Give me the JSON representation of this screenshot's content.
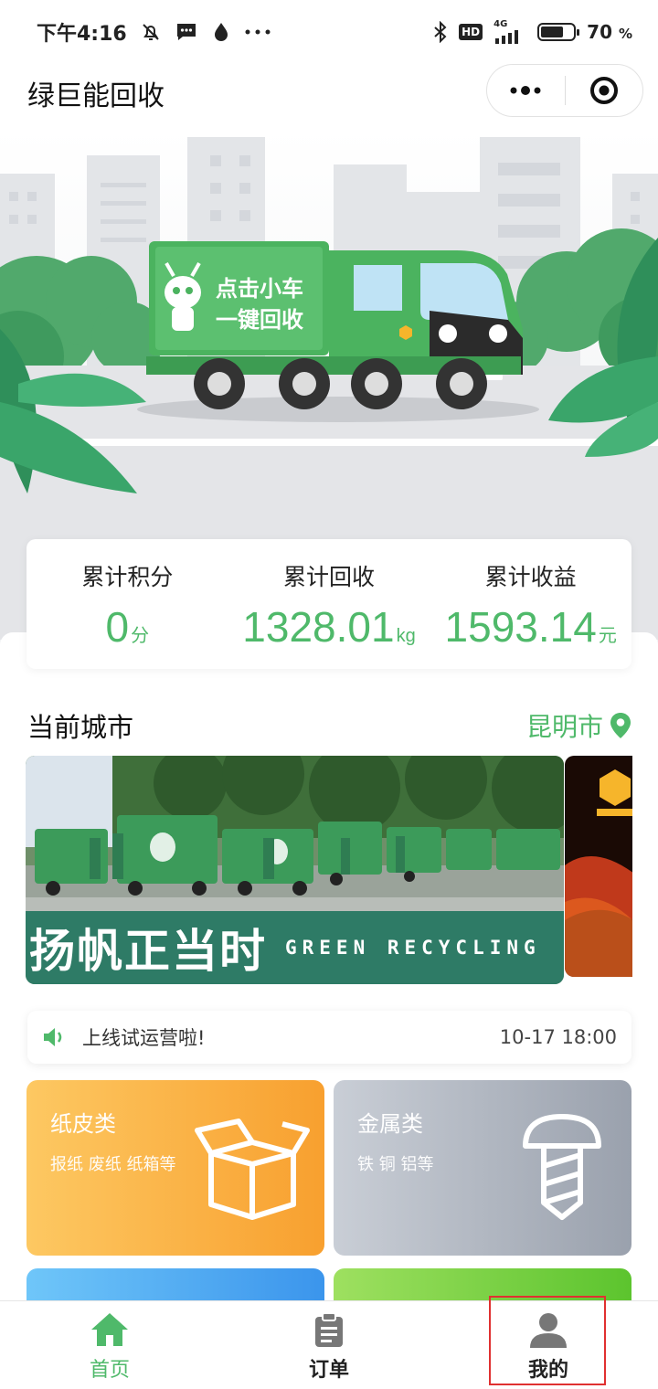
{
  "status_bar": {
    "time": "下午4:16",
    "network": "4G",
    "battery": "70",
    "battery_unit": "%",
    "battery_level": 0.7
  },
  "app": {
    "title": "绿巨能回收"
  },
  "banner": {
    "truck_text_line1": "点击小车",
    "truck_text_line2": "一键回收"
  },
  "stats": [
    {
      "label": "累计积分",
      "value": "0",
      "unit": "分"
    },
    {
      "label": "累计回收",
      "value": "1328.01",
      "unit": "kg"
    },
    {
      "label": "累计收益",
      "value": "1593.14",
      "unit": "元"
    }
  ],
  "city": {
    "title": "当前城市",
    "value": "昆明市"
  },
  "carousel": {
    "caption_cn": "扬帆正当时",
    "caption_en": "GREEN RECYCLING"
  },
  "notice": {
    "text": "上线试运营啦!",
    "time": "10-17 18:00"
  },
  "categories": [
    {
      "title": "纸皮类",
      "subtitle": "报纸 废纸 纸箱等",
      "icon": "box-icon"
    },
    {
      "title": "金属类",
      "subtitle": "铁 铜 铝等",
      "icon": "screw-icon"
    }
  ],
  "tabs": [
    {
      "label": "首页",
      "icon": "home-icon",
      "active": true
    },
    {
      "label": "订单",
      "icon": "clipboard-icon",
      "active": false
    },
    {
      "label": "我的",
      "icon": "user-icon",
      "active": false
    }
  ],
  "colors": {
    "accent": "#4fb96a",
    "paper_card": "#f8a02f",
    "metal_card": "#9aa1ad",
    "highlight": "#e03030"
  }
}
